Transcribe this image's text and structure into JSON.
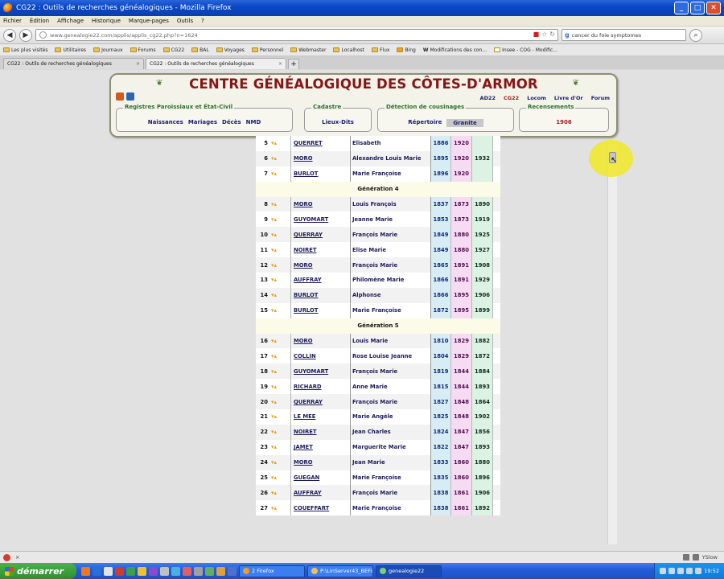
{
  "window": {
    "title": "CG22 : Outils de recherches généalogiques - Mozilla Firefox"
  },
  "menu": [
    "Fichier",
    "Édition",
    "Affichage",
    "Historique",
    "Marque-pages",
    "Outils",
    "?"
  ],
  "nav": {
    "url": "www.genealogie22.com/applis/applis_cg22.php?n=1624",
    "search": "cancer du foie symptomes"
  },
  "bookmarks": [
    "Les plus visités",
    "Utilitaires",
    "Journaux",
    "Forums",
    "CG22",
    "BAL",
    "Voyages",
    "Personnel",
    "Webmaster",
    "Localhost",
    "Flux",
    "Bing",
    "Modifications des con...",
    "Insee - COG - Modific..."
  ],
  "tabs": [
    {
      "label": "CG22 : Outils de recherches généalogiques"
    },
    {
      "label": "CG22 : Outils de recherches généalogiques"
    }
  ],
  "header": {
    "title": "CENTRE GÉNÉALOGIQUE DES CÔTES-D'ARMOR",
    "top_links": [
      "AD22",
      "CG22",
      "Locom",
      "Livre d'Or",
      "Forum"
    ],
    "groups": [
      {
        "legend": "Registres Paroissiaux et État-Civil",
        "links": [
          "Naissances",
          "Mariages",
          "Décès",
          "NMD"
        ]
      },
      {
        "legend": "Cadastre",
        "links": [
          "Lieux-Dits"
        ]
      },
      {
        "legend": "Détection de cousinages",
        "links": [
          "Répertoire",
          "Granite"
        ]
      },
      {
        "legend": "Recensements",
        "links": [
          "1906"
        ]
      }
    ]
  },
  "table": {
    "rows": [
      {
        "num": "5",
        "nom": "QUERRET",
        "prenom": "Elisabeth",
        "y1": "1886",
        "y2": "1920",
        "y3": ""
      },
      {
        "num": "6",
        "nom": "MORO",
        "prenom": "Alexandre Louis Marie",
        "y1": "1895",
        "y2": "1920",
        "y3": "1932"
      },
      {
        "num": "7",
        "nom": "BURLOT",
        "prenom": "Marie Françoise",
        "y1": "1896",
        "y2": "1920",
        "y3": ""
      },
      {
        "gen": "Génération 4"
      },
      {
        "num": "8",
        "nom": "MORO",
        "prenom": "Louis François",
        "y1": "1837",
        "y2": "1873",
        "y3": "1890"
      },
      {
        "num": "9",
        "nom": "GUYOMART",
        "prenom": "Jeanne Marie",
        "y1": "1853",
        "y2": "1873",
        "y3": "1919"
      },
      {
        "num": "10",
        "nom": "QUERRAY",
        "prenom": "François Marie",
        "y1": "1849",
        "y2": "1880",
        "y3": "1925"
      },
      {
        "num": "11",
        "nom": "NOIRET",
        "prenom": "Elise Marie",
        "y1": "1849",
        "y2": "1880",
        "y3": "1927"
      },
      {
        "num": "12",
        "nom": "MORO",
        "prenom": "François Marie",
        "y1": "1865",
        "y2": "1891",
        "y3": "1908"
      },
      {
        "num": "13",
        "nom": "AUFFRAY",
        "prenom": "Philomène Marie",
        "y1": "1866",
        "y2": "1891",
        "y3": "1929"
      },
      {
        "num": "14",
        "nom": "BURLOT",
        "prenom": "Alphonse",
        "y1": "1866",
        "y2": "1895",
        "y3": "1906"
      },
      {
        "num": "15",
        "nom": "BURLOT",
        "prenom": "Marie Françoise",
        "y1": "1872",
        "y2": "1895",
        "y3": "1899"
      },
      {
        "gen": "Génération 5"
      },
      {
        "num": "16",
        "nom": "MORO",
        "prenom": "Louis Marie",
        "y1": "1810",
        "y2": "1829",
        "y3": "1882"
      },
      {
        "num": "17",
        "nom": "COLLIN",
        "prenom": "Rose Louise Jeanne",
        "y1": "1804",
        "y2": "1829",
        "y3": "1872"
      },
      {
        "num": "18",
        "nom": "GUYOMART",
        "prenom": "François Marie",
        "y1": "1819",
        "y2": "1844",
        "y3": "1884"
      },
      {
        "num": "19",
        "nom": "RICHARD",
        "prenom": "Anne Marie",
        "y1": "1815",
        "y2": "1844",
        "y3": "1893"
      },
      {
        "num": "20",
        "nom": "QUERRAY",
        "prenom": "François Marie",
        "y1": "1827",
        "y2": "1848",
        "y3": "1864"
      },
      {
        "num": "21",
        "nom": "LE MEE",
        "prenom": "Marie Angèle",
        "y1": "1825",
        "y2": "1848",
        "y3": "1902"
      },
      {
        "num": "22",
        "nom": "NOIRET",
        "prenom": "Jean Charles",
        "y1": "1824",
        "y2": "1847",
        "y3": "1856"
      },
      {
        "num": "23",
        "nom": "JAMET",
        "prenom": "Marguerite Marie",
        "y1": "1822",
        "y2": "1847",
        "y3": "1893"
      },
      {
        "num": "24",
        "nom": "MORO",
        "prenom": "Jean Marie",
        "y1": "1833",
        "y2": "1860",
        "y3": "1880"
      },
      {
        "num": "25",
        "nom": "GUEGAN",
        "prenom": "Marie Françoise",
        "y1": "1835",
        "y2": "1860",
        "y3": "1896"
      },
      {
        "num": "26",
        "nom": "AUFFRAY",
        "prenom": "François Marie",
        "y1": "1838",
        "y2": "1861",
        "y3": "1906"
      },
      {
        "num": "27",
        "nom": "COUEFFART",
        "prenom": "Marie Françoise",
        "y1": "1838",
        "y2": "1861",
        "y3": "1892"
      }
    ]
  },
  "statusbar": {
    "right": "YSlow"
  },
  "taskbar": {
    "start": "démarrer",
    "tasks": [
      "2 Firefox",
      "P:\\LinServer43_BEFL...",
      "genealogie22"
    ],
    "clock": "19:52"
  }
}
